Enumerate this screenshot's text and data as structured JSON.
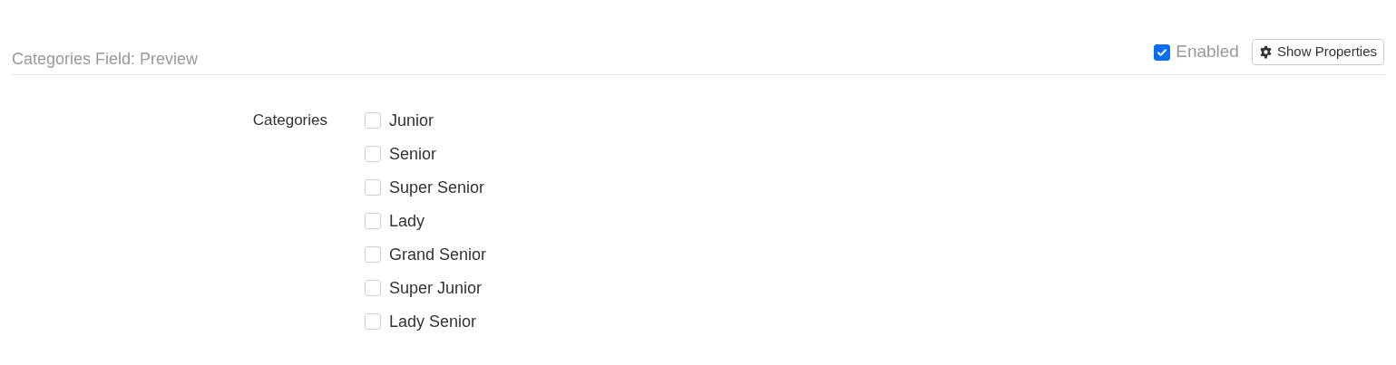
{
  "header": {
    "title": "Categories Field: Preview",
    "enabled": {
      "label": "Enabled",
      "checked": true
    },
    "properties_button": {
      "label": "Show Properties"
    }
  },
  "field": {
    "label": "Categories",
    "options": [
      {
        "label": "Junior",
        "checked": false
      },
      {
        "label": "Senior",
        "checked": false
      },
      {
        "label": "Super Senior",
        "checked": false
      },
      {
        "label": "Lady",
        "checked": false
      },
      {
        "label": "Grand Senior",
        "checked": false
      },
      {
        "label": "Super Junior",
        "checked": false
      },
      {
        "label": "Lady Senior",
        "checked": false
      }
    ]
  }
}
